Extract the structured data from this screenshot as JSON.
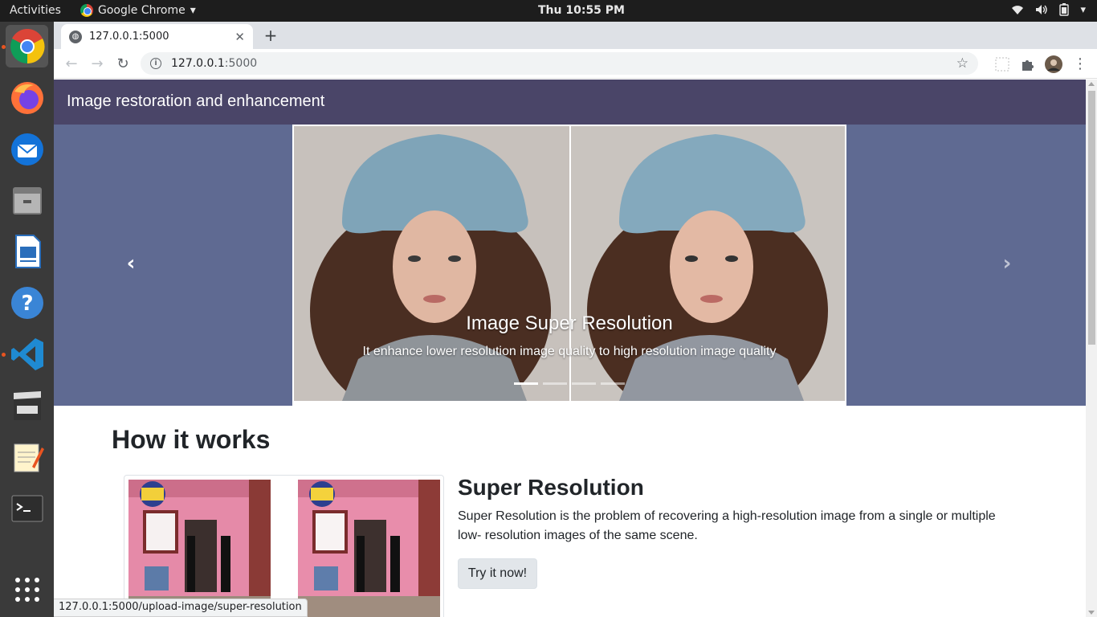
{
  "system": {
    "activities": "Activities",
    "app_name": "Google Chrome",
    "clock": "Thu 10:55 PM"
  },
  "dock": {
    "items": [
      "chrome-icon",
      "firefox-icon",
      "thunderbird-icon",
      "files-icon",
      "writer-icon",
      "help-icon",
      "vscode-icon",
      "video-editor-icon",
      "text-editor-icon",
      "terminal-icon",
      "app-grid-icon"
    ]
  },
  "browser": {
    "tab_title": "127.0.0.1:5000",
    "url_host": "127.0.0.1",
    "url_port": ":5000",
    "status_url": "127.0.0.1:5000/upload-image/super-resolution"
  },
  "page": {
    "navbar_title": "Image restoration and enhancement",
    "carousel": {
      "caption_title": "Image Super Resolution",
      "caption_text": "It enhance lower resolution image quality to high resolution image quality",
      "indicator_count": 4,
      "active_index": 0
    },
    "section_title": "How it works",
    "feature": {
      "title": "Super Resolution",
      "description": "Super Resolution is the problem of recovering a high-resolution image from a single or multiple low- resolution images of the same scene.",
      "button_label": "Try it now!"
    }
  },
  "colors": {
    "navbar": "#4a4568",
    "carousel_bg": "#5f6a92",
    "ubuntu_accent": "#e95420"
  }
}
